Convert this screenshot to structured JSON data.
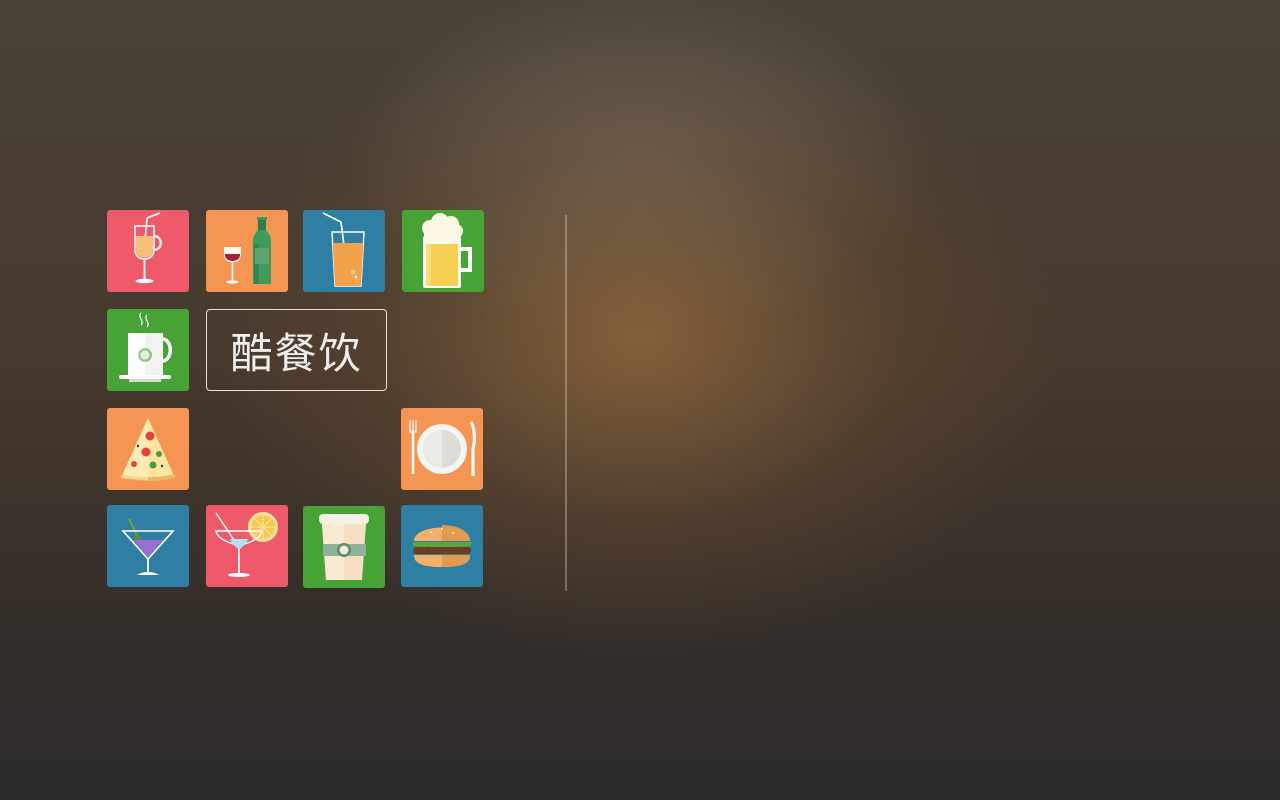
{
  "brand": {
    "title": "酷餐饮"
  },
  "tiles": [
    {
      "name": "juice-cup-tile",
      "icon": "juice-cup-icon",
      "color": "#ef5a6a"
    },
    {
      "name": "wine-bottle-tile",
      "icon": "wine-bottle-icon",
      "color": "#f49553"
    },
    {
      "name": "orange-drink-tile",
      "icon": "orange-drink-icon",
      "color": "#2f7fa4"
    },
    {
      "name": "beer-mug-tile",
      "icon": "beer-mug-icon",
      "color": "#48a336"
    },
    {
      "name": "coffee-mug-tile",
      "icon": "coffee-mug-icon",
      "color": "#48a336"
    },
    {
      "name": "pizza-tile",
      "icon": "pizza-slice-icon",
      "color": "#f49553"
    },
    {
      "name": "dining-plate-tile",
      "icon": "plate-fork-knife-icon",
      "color": "#f49553"
    },
    {
      "name": "martini-tile",
      "icon": "martini-glass-icon",
      "color": "#2f7fa4"
    },
    {
      "name": "cocktail-tile",
      "icon": "cocktail-lemon-icon",
      "color": "#ef5a6a"
    },
    {
      "name": "takeaway-coffee-tile",
      "icon": "takeaway-cup-icon",
      "color": "#48a336"
    },
    {
      "name": "burger-tile",
      "icon": "burger-icon",
      "color": "#2f7fa4"
    }
  ]
}
